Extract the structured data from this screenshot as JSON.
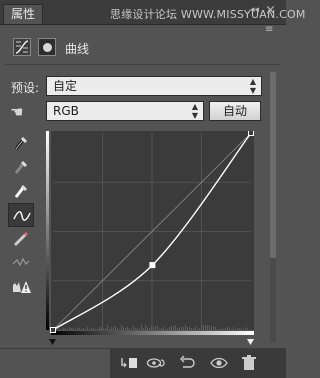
{
  "panel": {
    "tab_label": "属性",
    "watermark": "思缘设计论坛 WWW.MISSYUAN.COM",
    "collapse_glyph": "◂◂",
    "close_glyph": "×",
    "menu_glyph": "≡",
    "adjustment_title": "曲线"
  },
  "preset": {
    "label": "预设:",
    "value": "自定"
  },
  "channel": {
    "value": "RGB",
    "auto_button": "自动"
  },
  "tools": [
    "curve-point-icon",
    "black-eyedropper-icon",
    "gray-eyedropper-icon",
    "white-eyedropper-icon",
    "smooth-curve-icon",
    "pencil-icon",
    "smooth-icon",
    "clipping-warning-icon"
  ],
  "curve": {
    "points": [
      [
        0,
        0
      ],
      [
        128,
        84
      ],
      [
        255,
        255
      ]
    ],
    "grid_divisions": 4,
    "show_histogram": true
  },
  "bottom_icons": [
    "clip-to-layer-icon",
    "view-previous-icon",
    "reset-icon",
    "visibility-icon",
    "delete-icon"
  ],
  "colors": {
    "panel_bg": "#535353",
    "graph_bg": "#3b3b3b",
    "curve": "#ffffff"
  }
}
